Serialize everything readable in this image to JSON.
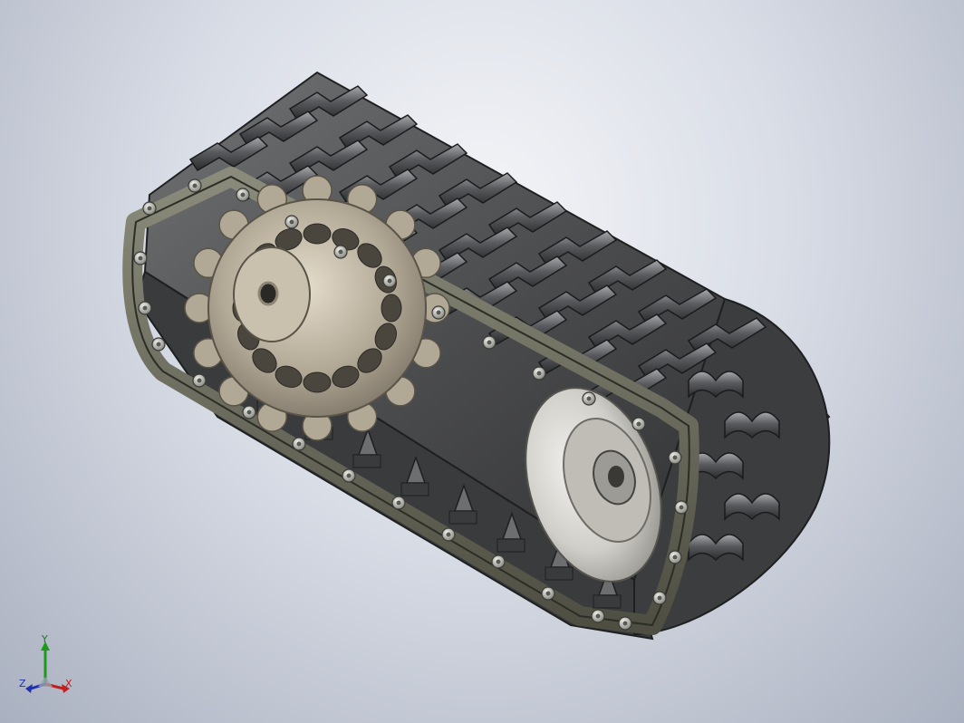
{
  "viewport": {
    "background_colors": [
      "#f4f5f8",
      "#a9b0bf"
    ]
  },
  "model": {
    "description_icon": "track-assembly-icon",
    "colors": {
      "tread": "#4a4b4d",
      "tread_highlight": "#8d8f93",
      "side_plate": "#5f6052",
      "sprocket": "#b2a896",
      "wheel": "#d8d6d0",
      "bolt": "#c9c9c4"
    }
  },
  "triad": {
    "x_label": "X",
    "y_label": "Y",
    "z_label": "Z",
    "colors": {
      "x": "#c02020",
      "y": "#1c7a1c",
      "z": "#2030b0"
    }
  }
}
